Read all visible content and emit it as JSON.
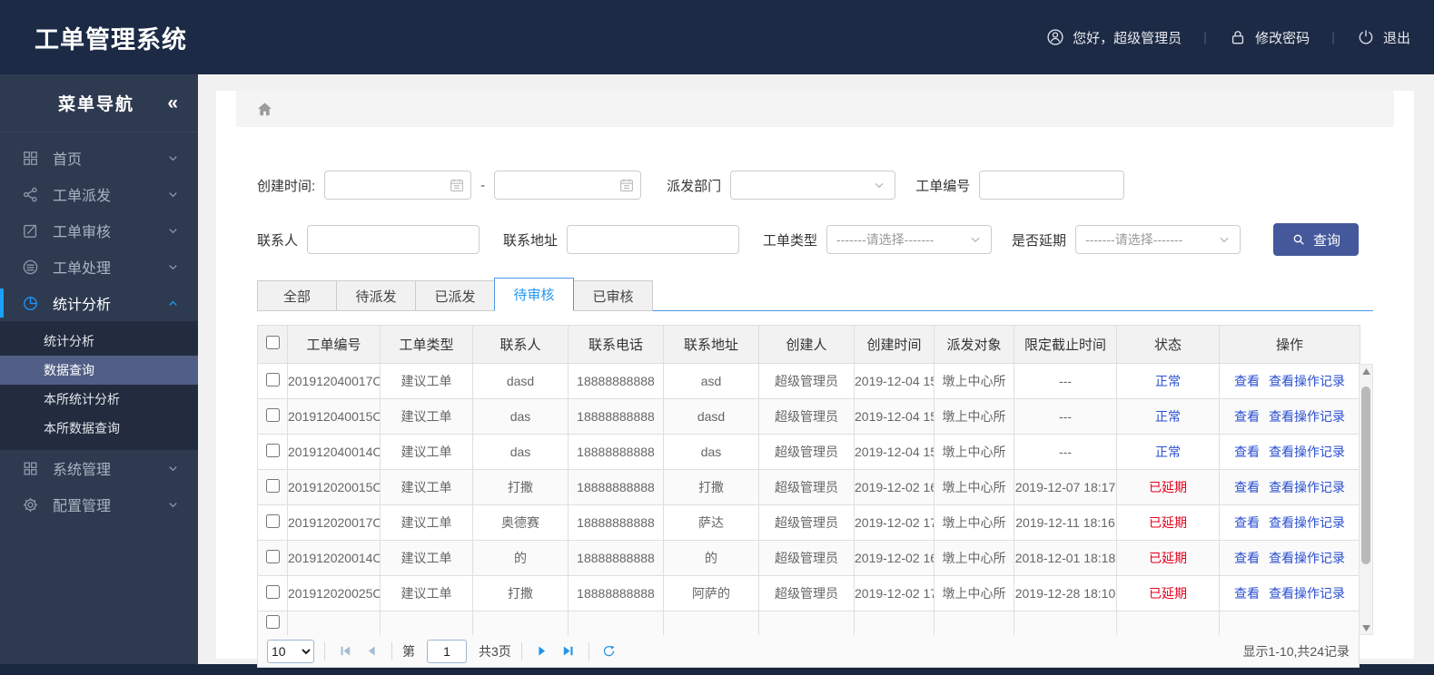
{
  "header": {
    "title": "工单管理系统",
    "greeting": "您好，超级管理员",
    "change_password": "修改密码",
    "logout": "退出",
    "divider": "|"
  },
  "sidebar": {
    "title": "菜单导航",
    "collapse_glyph": "«",
    "items": [
      {
        "label": "首页",
        "icon": "grid-icon"
      },
      {
        "label": "工单派发",
        "icon": "share-icon"
      },
      {
        "label": "工单审核",
        "icon": "edit-icon"
      },
      {
        "label": "工单处理",
        "icon": "process-icon"
      },
      {
        "label": "统计分析",
        "icon": "pie-chart-icon"
      },
      {
        "label": "系统管理",
        "icon": "apps-icon"
      },
      {
        "label": "配置管理",
        "icon": "gear-icon"
      }
    ],
    "submenu": [
      {
        "label": "统计分析",
        "selected": false
      },
      {
        "label": "数据查询",
        "selected": true
      },
      {
        "label": "本所统计分析",
        "selected": false
      },
      {
        "label": "本所数据查询",
        "selected": false
      }
    ]
  },
  "filters": {
    "created_time_label": "创建时间:",
    "date_start_value": "",
    "date_end_value": "",
    "date_range_separator": "-",
    "department_label": "派发部门",
    "department_value": "",
    "order_no_label": "工单编号",
    "order_no_value": "",
    "contact_label": "联系人",
    "contact_value": "",
    "address_label": "联系地址",
    "address_value": "",
    "order_type_label": "工单类型",
    "order_type_value": "-------请选择-------",
    "delay_label": "是否延期",
    "delay_value": "-------请选择-------",
    "search_button": "查询"
  },
  "tabs": [
    {
      "label": "全部",
      "active": false
    },
    {
      "label": "待派发",
      "active": false
    },
    {
      "label": "已派发",
      "active": false
    },
    {
      "label": "待审核",
      "active": true
    },
    {
      "label": "已审核",
      "active": false
    }
  ],
  "table": {
    "columns": [
      "工单编号",
      "工单类型",
      "联系人",
      "联系电话",
      "联系地址",
      "创建人",
      "创建时间",
      "派发对象",
      "限定截止时间",
      "状态",
      "操作"
    ],
    "action_labels": [
      "查看",
      "查看操作记录"
    ],
    "rows": [
      {
        "order_no": "201912040017C",
        "type": "建议工单",
        "contact": "dasd",
        "phone": "18888888888",
        "address": "asd",
        "creator": "超级管理员",
        "created": "2019-12-04 15",
        "target": "墩上中心所",
        "deadline": "---",
        "status": "正常",
        "status_type": "normal"
      },
      {
        "order_no": "201912040015C",
        "type": "建议工单",
        "contact": "das",
        "phone": "18888888888",
        "address": "dasd",
        "creator": "超级管理员",
        "created": "2019-12-04 15",
        "target": "墩上中心所",
        "deadline": "---",
        "status": "正常",
        "status_type": "normal"
      },
      {
        "order_no": "201912040014C",
        "type": "建议工单",
        "contact": "das",
        "phone": "18888888888",
        "address": "das",
        "creator": "超级管理员",
        "created": "2019-12-04 15",
        "target": "墩上中心所",
        "deadline": "---",
        "status": "正常",
        "status_type": "normal"
      },
      {
        "order_no": "201912020015C",
        "type": "建议工单",
        "contact": "打撒",
        "phone": "18888888888",
        "address": "打撒",
        "creator": "超级管理员",
        "created": "2019-12-02 16",
        "target": "墩上中心所",
        "deadline": "2019-12-07 18:17",
        "status": "已延期",
        "status_type": "delayed"
      },
      {
        "order_no": "201912020017C",
        "type": "建议工单",
        "contact": "奥德赛",
        "phone": "18888888888",
        "address": "萨达",
        "creator": "超级管理员",
        "created": "2019-12-02 17",
        "target": "墩上中心所",
        "deadline": "2019-12-11 18:16",
        "status": "已延期",
        "status_type": "delayed"
      },
      {
        "order_no": "201912020014C",
        "type": "建议工单",
        "contact": "的",
        "phone": "18888888888",
        "address": "的",
        "creator": "超级管理员",
        "created": "2019-12-02 16",
        "target": "墩上中心所",
        "deadline": "2018-12-01 18:18",
        "status": "已延期",
        "status_type": "delayed"
      },
      {
        "order_no": "201912020025C",
        "type": "建议工单",
        "contact": "打撒",
        "phone": "18888888888",
        "address": "阿萨的",
        "creator": "超级管理员",
        "created": "2019-12-02 17",
        "target": "墩上中心所",
        "deadline": "2019-12-28 18:10",
        "status": "已延期",
        "status_type": "delayed"
      }
    ]
  },
  "pagination": {
    "page_size": "10",
    "page_prefix": "第",
    "page_value": "1",
    "total_pages": "共3页",
    "record_info": "显示1-10,共24记录"
  },
  "colors": {
    "header_bg": "#1c2a45",
    "sidebar_bg": "#2d3a50",
    "submenu_selected_bg": "#515e85",
    "accent_blue": "#2196f3",
    "search_button_bg": "#45589b",
    "link_blue": "#2a4fd0",
    "status_red": "#e8001c"
  }
}
